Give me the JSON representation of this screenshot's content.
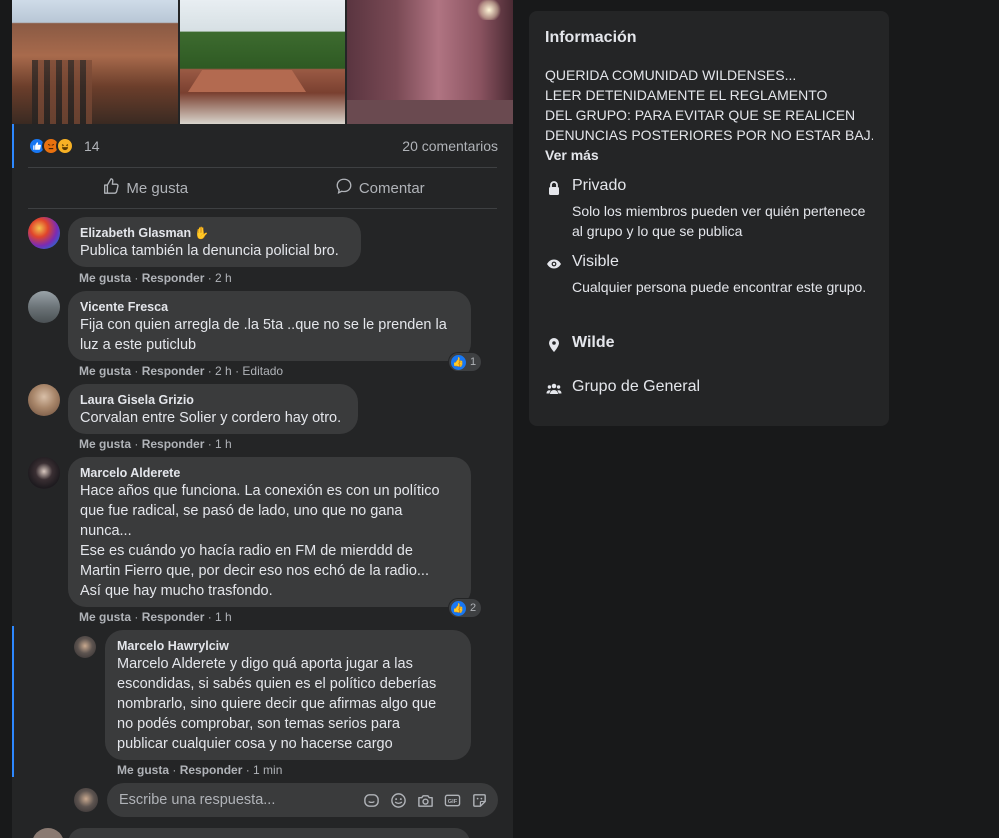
{
  "post": {
    "reactions_count": "14",
    "comments_count": "20 comentarios",
    "actions": {
      "like": "Me gusta",
      "comment": "Comentar"
    }
  },
  "comments": [
    {
      "name": "Elizabeth Glasman",
      "text": "Publica también la denuncia policial bro.",
      "like": "Me gusta",
      "reply": "Responder",
      "time": "2 h"
    },
    {
      "name": "Vicente Fresca",
      "text": "Fija con quien arregla de .la 5ta ..que no se le prenden la\nluz a este puticlub",
      "like": "Me gusta",
      "reply": "Responder",
      "time": "2 h",
      "edited": "Editado",
      "likes": "1"
    },
    {
      "name": "Laura Gisela Grizio",
      "text": "Corvalan entre Solier y cordero hay otro.",
      "like": "Me gusta",
      "reply": "Responder",
      "time": "1 h"
    },
    {
      "name": "Marcelo Alderete",
      "text": "Hace años que funciona. La conexión es con un político\nque fue radical, se pasó de lado, uno que no gana\nnunca...\nEse es cuándo yo hacía radio en FM de mierddd de\nMartin Fierro que, por decir eso nos echó de la radio...\nAsí que hay mucho trasfondo.",
      "like": "Me gusta",
      "reply": "Responder",
      "time": "1 h",
      "likes": "2"
    }
  ],
  "reply": {
    "name": "Marcelo Hawrylciw",
    "text": "Marcelo Alderete y digo quá aporta jugar a las\nescondidas, si sabés quien es el político deberías\nnombrarlo, sino quiere decir que afirmas algo que\nno podés comprobar, son temas serios para\npublicar cualquier cosa y no hacerse cargo",
    "like": "Me gusta",
    "reply": "Responder",
    "time": "1 min"
  },
  "reply_box": {
    "placeholder": "Escribe una respuesta..."
  },
  "info": {
    "title": "Información",
    "description_lines": [
      "QUERIDA COMUNIDAD WILDENSES...",
      "LEER DETENIDAMENTE EL REGLAMENTO",
      "DEL GRUPO: PARA EVITAR QUE SE REALICEN",
      "DENUNCIAS POSTERIORES POR NO ESTAR BAJ..."
    ],
    "see_more": "Ver más",
    "privacy": {
      "title": "Privado",
      "subtitle": "Solo los miembros pueden ver quién pertenece al grupo y lo que se publica"
    },
    "visibility": {
      "title": "Visible",
      "subtitle": "Cualquier persona puede encontrar este grupo."
    },
    "location": "Wilde",
    "category": "Grupo de General"
  },
  "colors": {
    "background": "#18191a",
    "card": "#242526",
    "bubble": "#3a3b3c",
    "accent": "#2d88ff",
    "like_blue": "#1877f2"
  },
  "icons": [
    "like-icon",
    "angry-icon",
    "haha-icon",
    "thumbs-up-icon",
    "comment-icon",
    "lock-icon",
    "eye-icon",
    "location-pin-icon",
    "group-icon",
    "sticker-icon",
    "emoji-icon",
    "camera-icon",
    "gif-icon",
    "sticker-face-icon"
  ]
}
